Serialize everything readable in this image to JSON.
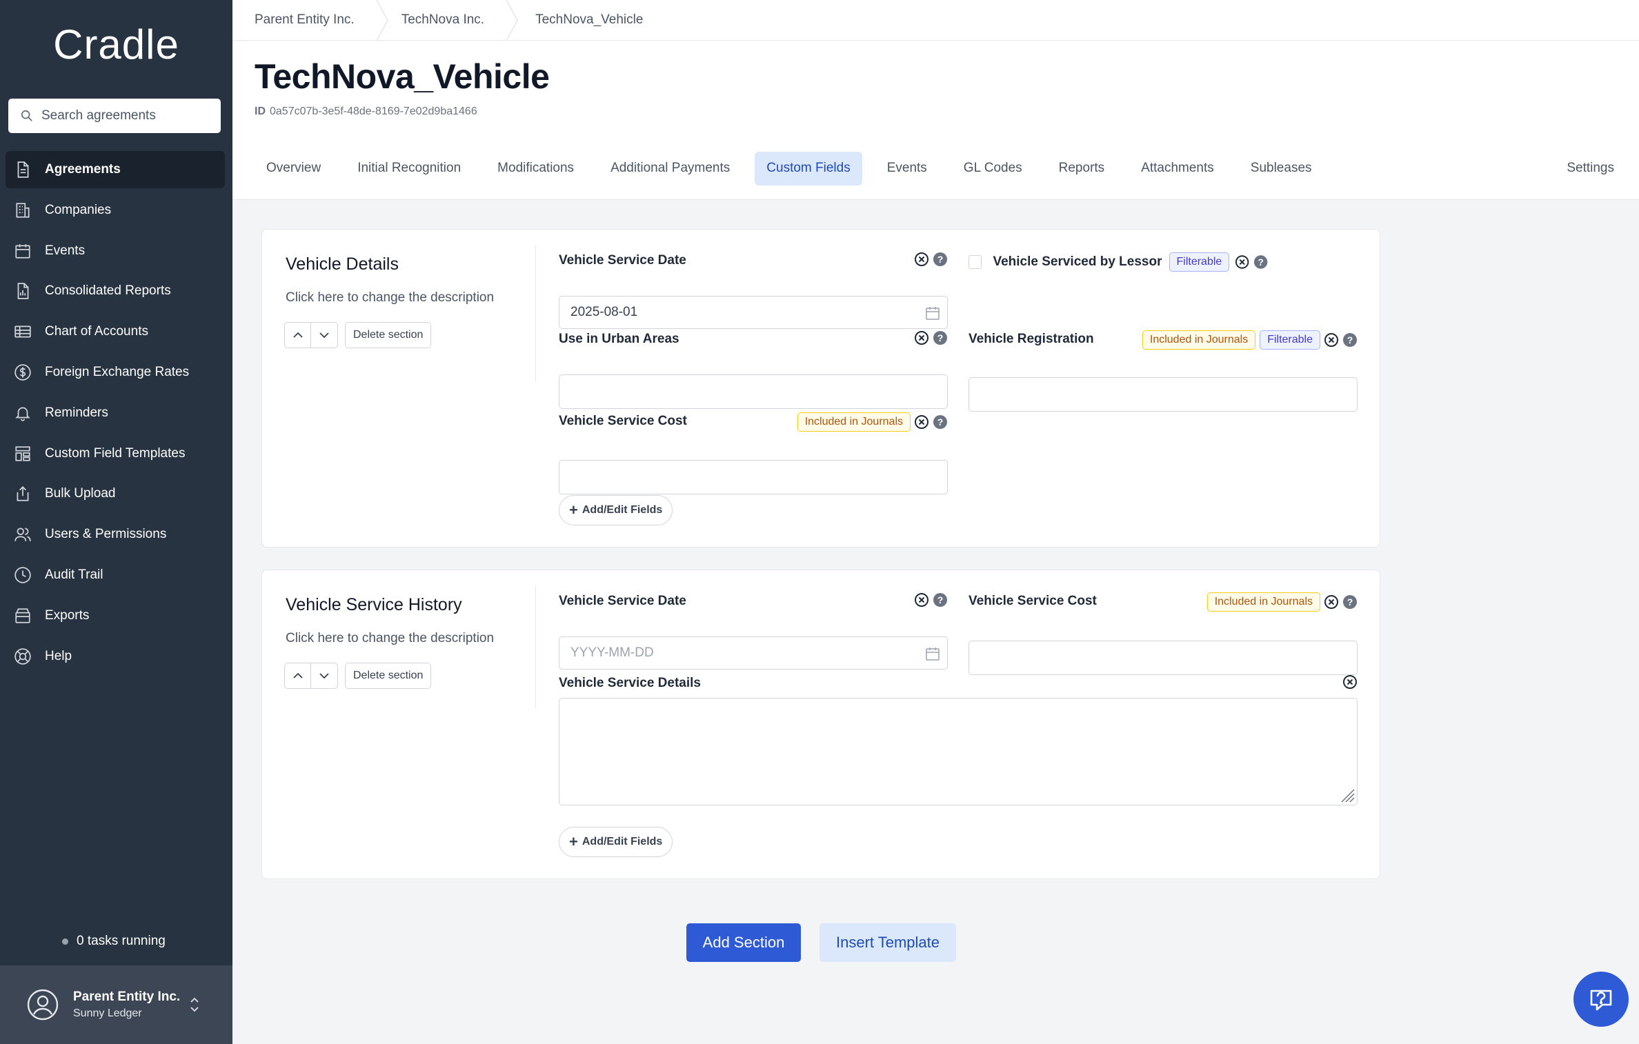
{
  "sidebar": {
    "logo": "Cradle",
    "search_placeholder": "Search agreements",
    "items": [
      {
        "label": "Agreements",
        "icon": "document-icon",
        "active": true
      },
      {
        "label": "Companies",
        "icon": "building-icon"
      },
      {
        "label": "Events",
        "icon": "calendar-icon"
      },
      {
        "label": "Consolidated Reports",
        "icon": "chart-document-icon"
      },
      {
        "label": "Chart of Accounts",
        "icon": "table-icon"
      },
      {
        "label": "Foreign Exchange Rates",
        "icon": "dollar-circle-icon"
      },
      {
        "label": "Reminders",
        "icon": "bell-icon"
      },
      {
        "label": "Custom Field Templates",
        "icon": "template-icon"
      },
      {
        "label": "Bulk Upload",
        "icon": "upload-icon"
      },
      {
        "label": "Users & Permissions",
        "icon": "users-icon"
      },
      {
        "label": "Audit Trail",
        "icon": "clock-icon"
      },
      {
        "label": "Exports",
        "icon": "archive-icon"
      },
      {
        "label": "Help",
        "icon": "lifebuoy-icon"
      }
    ],
    "tasks": "0 tasks running",
    "account": {
      "org": "Parent Entity Inc.",
      "user": "Sunny Ledger"
    }
  },
  "breadcrumb": [
    "Parent Entity Inc.",
    "TechNova Inc.",
    "TechNova_Vehicle"
  ],
  "page": {
    "title": "TechNova_Vehicle",
    "id_label": "ID",
    "id_value": "0a57c07b-3e5f-48de-8169-7e02d9ba1466"
  },
  "tabs": [
    "Overview",
    "Initial Recognition",
    "Modifications",
    "Additional Payments",
    "Custom Fields",
    "Events",
    "GL Codes",
    "Reports",
    "Attachments",
    "Subleases"
  ],
  "active_tab": "Custom Fields",
  "settings_tab": "Settings",
  "tags": {
    "journal": "Included in Journals",
    "filter": "Filterable"
  },
  "sections": [
    {
      "title": "Vehicle Details",
      "description": "Click here to change the description",
      "delete_label": "Delete section",
      "fields": {
        "service_date": {
          "label": "Vehicle Service Date",
          "value": "2025-08-01"
        },
        "serviced_by_lessor": {
          "label": "Vehicle Serviced by Lessor"
        },
        "urban_areas": {
          "label": "Use in Urban Areas",
          "value": ""
        },
        "registration": {
          "label": "Vehicle Registration",
          "value": ""
        },
        "service_cost": {
          "label": "Vehicle Service Cost",
          "value": ""
        }
      },
      "add_edit_label": "Add/Edit Fields"
    },
    {
      "title": "Vehicle Service History",
      "description": "Click here to change the description",
      "delete_label": "Delete section",
      "fields": {
        "service_date": {
          "label": "Vehicle Service Date",
          "placeholder": "YYYY-MM-DD"
        },
        "service_cost": {
          "label": "Vehicle Service Cost",
          "value": ""
        },
        "service_details": {
          "label": "Vehicle Service Details",
          "value": ""
        }
      },
      "add_edit_label": "Add/Edit Fields"
    }
  ],
  "actions": {
    "add_section": "Add Section",
    "insert_template": "Insert Template"
  },
  "colors": {
    "sidebar_bg": "#283341",
    "primary": "#2e5ad6",
    "tab_active_bg": "#dbe7fb",
    "journal_tag": "#b45309",
    "filter_tag": "#4338ca"
  }
}
